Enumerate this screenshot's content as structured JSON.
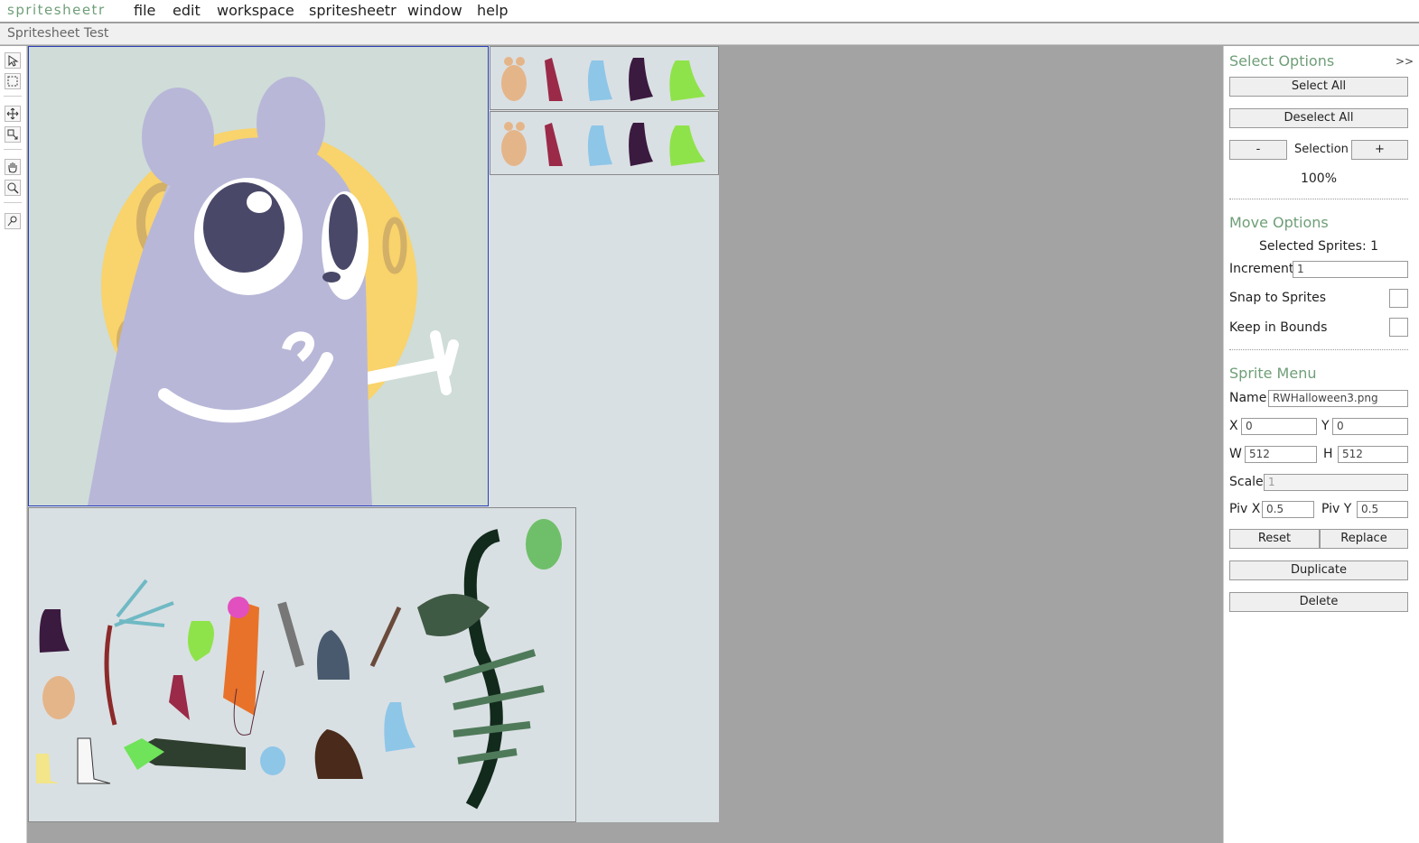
{
  "app": {
    "brand": "spritesheetr",
    "document_title": "Spritesheet Test"
  },
  "menu": [
    "file",
    "edit",
    "workspace",
    "spritesheetr",
    "window",
    "help"
  ],
  "tools": [
    "select-arrow-icon",
    "marquee-icon",
    "move-icon",
    "resize-icon",
    "hand-icon",
    "zoom-icon",
    "pivot-icon"
  ],
  "colors": {
    "accent": "#6f9e78",
    "canvas_bg": "#d9e0e3",
    "workspace_bg": "#a3a3a3",
    "selection_border": "#2b3fb8"
  },
  "select_options": {
    "title": "Select Options",
    "collapse": ">>",
    "select_all": "Select All",
    "deselect_all": "Deselect All",
    "minus": "-",
    "selection_label": "Selection",
    "plus": "+",
    "zoom": "100%"
  },
  "move_options": {
    "title": "Move Options",
    "selected_sprites": "Selected Sprites: 1",
    "increment_label": "Increment",
    "increment_value": "1",
    "snap_label": "Snap to Sprites",
    "bounds_label": "Keep in Bounds"
  },
  "sprite_menu": {
    "title": "Sprite Menu",
    "name_label": "Name",
    "name_value": "RWHalloween3.png",
    "x_label": "X",
    "x_value": "0",
    "y_label": "Y",
    "y_value": "0",
    "w_label": "W",
    "w_value": "512",
    "h_label": "H",
    "h_value": "512",
    "scale_label": "Scale",
    "scale_value": "1",
    "pivx_label": "Piv X",
    "pivx_value": "0.5",
    "pivy_label": "Piv Y",
    "pivy_value": "0.5",
    "reset": "Reset",
    "replace": "Replace",
    "duplicate": "Duplicate",
    "delete": "Delete"
  }
}
